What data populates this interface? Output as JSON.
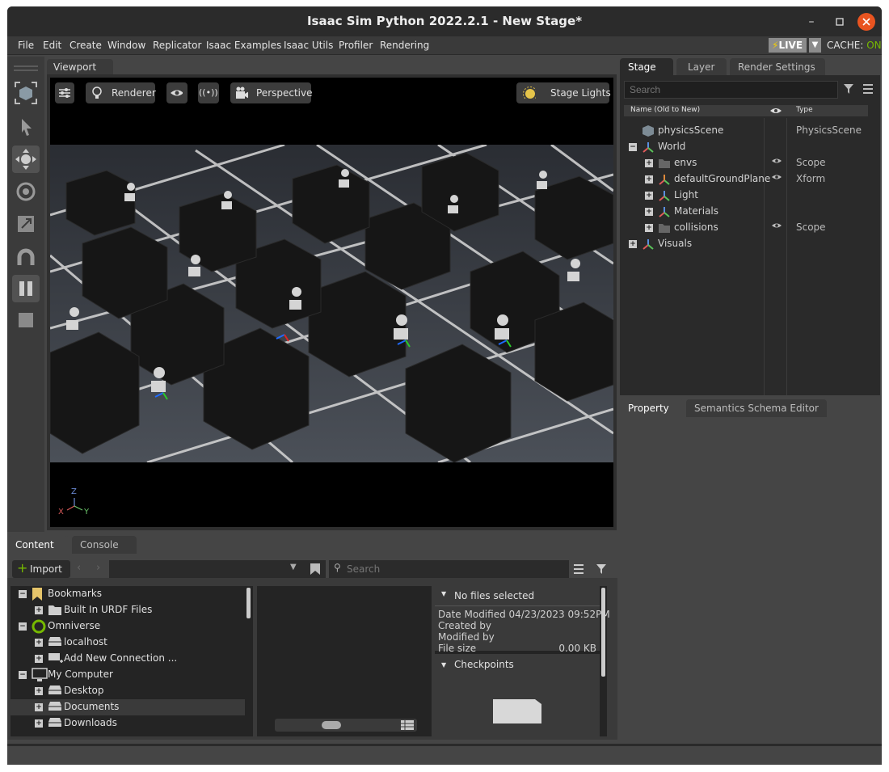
{
  "window": {
    "title": "Isaac Sim Python 2022.2.1 - New Stage*"
  },
  "menu": {
    "items": [
      "File",
      "Edit",
      "Create",
      "Window",
      "Replicator",
      "Isaac Examples",
      "Isaac Utils",
      "Profiler",
      "Rendering"
    ],
    "live_label": "LIVE",
    "cache_label": "CACHE:",
    "cache_value": "ON"
  },
  "viewport": {
    "tab": "Viewport",
    "buttons": {
      "renderer": "Renderer",
      "camera": "Perspective",
      "lights": "Stage Lights"
    },
    "axis_labels": {
      "z": "Z",
      "x": "X",
      "y": "Y"
    }
  },
  "right_tabs": [
    "Stage",
    "Layer",
    "Render Settings"
  ],
  "stage": {
    "search_placeholder": "Search",
    "columns": {
      "name": "Name (Old to New)",
      "type": "Type"
    },
    "rows": [
      {
        "name": "physicsScene",
        "type": "PhysicsScene",
        "icon": "cube-icon",
        "expander": "",
        "eye": false,
        "indent": 0
      },
      {
        "name": "World",
        "type": "",
        "icon": "xform-icon",
        "expander": "−",
        "eye": false,
        "indent": 0
      },
      {
        "name": "envs",
        "type": "Scope",
        "icon": "folder-icon",
        "expander": "+",
        "eye": true,
        "indent": 1
      },
      {
        "name": "defaultGroundPlane",
        "type": "Xform",
        "icon": "ground-icon",
        "expander": "+",
        "eye": true,
        "indent": 1
      },
      {
        "name": "Light",
        "type": "",
        "icon": "xform-icon",
        "expander": "+",
        "eye": false,
        "indent": 1
      },
      {
        "name": "Materials",
        "type": "",
        "icon": "xform-icon",
        "expander": "+",
        "eye": false,
        "indent": 1
      },
      {
        "name": "collisions",
        "type": "Scope",
        "icon": "folder-icon",
        "expander": "+",
        "eye": true,
        "indent": 1
      },
      {
        "name": "Visuals",
        "type": "",
        "icon": "xform-icon",
        "expander": "+",
        "eye": false,
        "indent": 0
      }
    ]
  },
  "property_tabs": [
    "Property",
    "Semantics Schema Editor"
  ],
  "content": {
    "tabs": [
      "Content",
      "Console"
    ],
    "import_label": "Import",
    "search_placeholder": "Search",
    "tree": [
      {
        "label": "Bookmarks",
        "expander": "−",
        "indent": 0,
        "icon": "bookmark-icon"
      },
      {
        "label": "Built In URDF Files",
        "expander": "+",
        "indent": 1,
        "icon": "folder-icon"
      },
      {
        "label": "Omniverse",
        "expander": "−",
        "indent": 0,
        "icon": "omniverse-icon"
      },
      {
        "label": "localhost",
        "expander": "+",
        "indent": 1,
        "icon": "drive-icon"
      },
      {
        "label": "Add New Connection ...",
        "expander": "+",
        "indent": 1,
        "icon": "add-connection-icon"
      },
      {
        "label": "My Computer",
        "expander": "−",
        "indent": 0,
        "icon": "computer-icon"
      },
      {
        "label": "Desktop",
        "expander": "+",
        "indent": 1,
        "icon": "drive-icon"
      },
      {
        "label": "Documents",
        "expander": "+",
        "indent": 1,
        "icon": "drive-icon",
        "selected": true
      },
      {
        "label": "Downloads",
        "expander": "+",
        "indent": 1,
        "icon": "drive-icon"
      }
    ],
    "info": {
      "header": "No files selected",
      "date_modified": "Date Modified 04/23/2023 09:52PM",
      "created_by": "Created by",
      "modified_by": "Modified by",
      "file_size_label": "File size",
      "file_size_value": "0.00 KB",
      "checkpoints": "Checkpoints"
    }
  },
  "colors": {
    "accent_green": "#76b900",
    "close_button": "#e95420"
  }
}
